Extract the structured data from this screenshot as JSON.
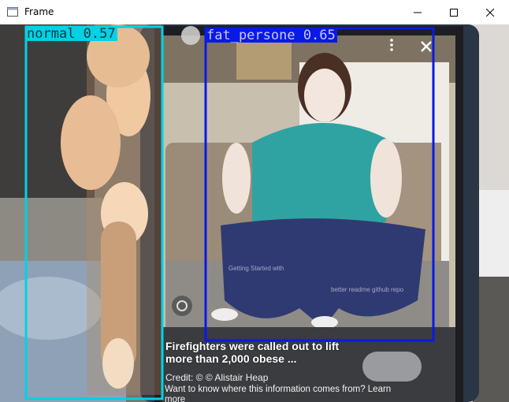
{
  "window": {
    "title": "Frame",
    "controls": {
      "minimize": "minimize",
      "maximize": "maximize",
      "close": "close"
    }
  },
  "detections": [
    {
      "label": "normal 0.57",
      "class": "normal",
      "score": 0.57,
      "color": "#00d2e6"
    },
    {
      "label": "fat_persone 0.65",
      "class": "fat_persone",
      "score": 0.65,
      "color": "#0a1ae6"
    }
  ],
  "phone_screen": {
    "headline": "Firefighters were called out to lift more than 2,000 obese ...",
    "credit": "Credit: © © Alistair Heap",
    "body": "Want to know where this information comes from? Learn more",
    "faded_captions": [
      "Getting Started with",
      "better readme github repo"
    ]
  }
}
